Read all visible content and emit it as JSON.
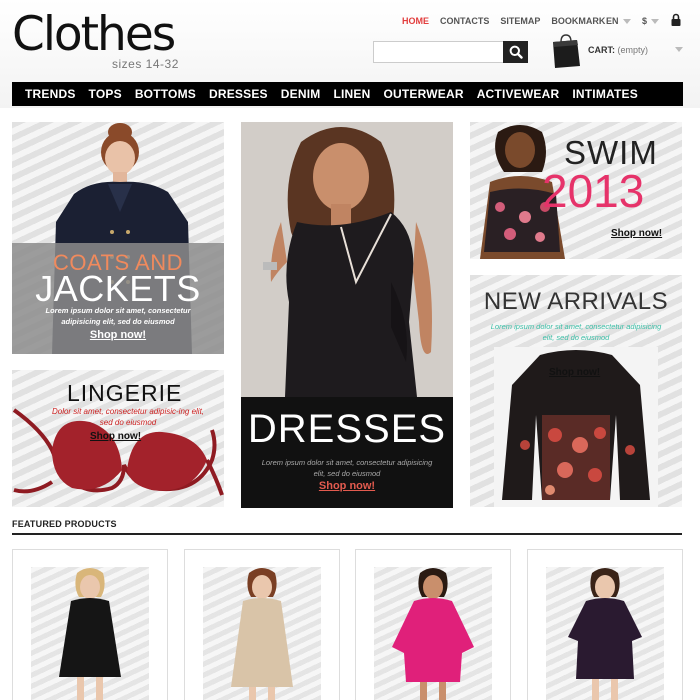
{
  "brand": {
    "title": "Clothes",
    "subtitle": "sizes 14-32"
  },
  "top_links": [
    "HOME",
    "CONTACTS",
    "SITEMAP",
    "BOOKMARK"
  ],
  "active_top_link": "HOME",
  "language": "EN",
  "currency": "$",
  "search": {
    "value": "",
    "placeholder": ""
  },
  "cart": {
    "label": "CART:",
    "value": "(empty)"
  },
  "nav": [
    "TRENDS",
    "TOPS",
    "BOTTOMS",
    "DRESSES",
    "DENIM",
    "LINEN",
    "OUTERWEAR",
    "ACTIVEWEAR",
    "INTIMATES"
  ],
  "banners": {
    "coats": {
      "line1": "COATS AND",
      "line2": "JACKETS",
      "text": "Lorem ipsum dolor sit amet, consectetur adipisicing elit, sed do eiusmod",
      "link": "Shop now!"
    },
    "lingerie": {
      "title": "LINGERIE",
      "text": "Dolor sit amet, consectetur adipisic-ing elit, sed do eiusmod",
      "link": "Shop now!"
    },
    "dresses": {
      "title": "DRESSES",
      "text": "Lorem ipsum dolor sit amet, consectetur adipisicing elit, sed do eiusmod",
      "link": "Shop now!"
    },
    "swim": {
      "title": "SWIM",
      "year": "2013",
      "link": "Shop now!"
    },
    "arrivals": {
      "title": "NEW ARRIVALS",
      "text": "Lorem ipsum dolor sit amet, consectetur adipisicing elit, sed do eiusmod",
      "link": "Shop now!"
    }
  },
  "featured": {
    "title": "FEATURED PRODUCTS",
    "products": [
      {
        "dress_color": "#151515"
      },
      {
        "dress_color": "#d9c4a8"
      },
      {
        "dress_color": "#e0207a"
      },
      {
        "dress_color": "#2a1a30"
      }
    ]
  },
  "colors": {
    "accent": "#e23d3d",
    "nav_bg": "#000000",
    "swim_pink": "#e6336a",
    "teal": "#3bbfa7"
  }
}
